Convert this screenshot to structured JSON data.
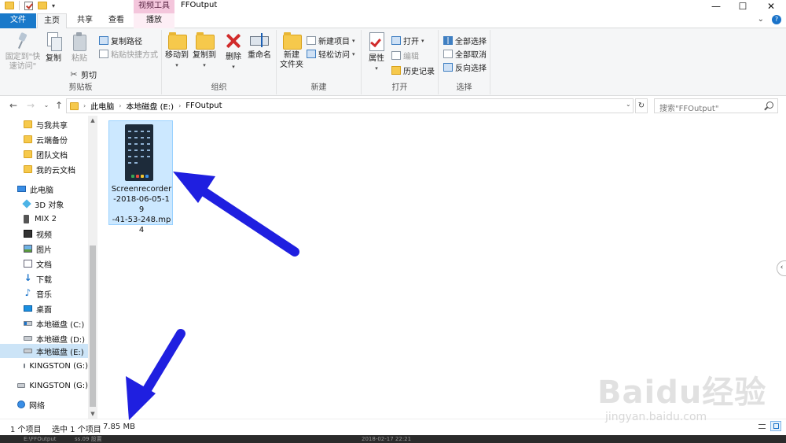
{
  "window": {
    "context_tab": "视频工具",
    "title": "FFOutput",
    "controls": {
      "minimize": "—",
      "maximize": "☐",
      "close": "✕"
    }
  },
  "tabs": {
    "file": "文件",
    "home": "主页",
    "share": "共享",
    "view": "查看",
    "play": "播放",
    "expand": "⌄"
  },
  "ribbon": {
    "clipboard": {
      "label": "剪贴板",
      "pin": "固定到\"快速访问\"",
      "copy": "复制",
      "paste": "粘贴",
      "copy_path": "复制路径",
      "paste_shortcut": "粘贴快捷方式",
      "cut": "剪切"
    },
    "organize": {
      "label": "组织",
      "move_to": "移动到",
      "copy_to": "复制到",
      "delete": "删除",
      "rename": "重命名"
    },
    "new": {
      "label": "新建",
      "new_folder": "新建\n文件夹",
      "new_item": "新建项目",
      "easy_access": "轻松访问"
    },
    "open": {
      "label": "打开",
      "properties": "属性",
      "open": "打开",
      "edit": "编辑",
      "history": "历史记录"
    },
    "select": {
      "label": "选择",
      "select_all": "全部选择",
      "select_none": "全部取消",
      "invert": "反向选择"
    }
  },
  "address": {
    "crumbs": [
      "此电脑",
      "本地磁盘 (E:)",
      "FFOutput"
    ],
    "search_placeholder": "搜索\"FFOutput\""
  },
  "nav": {
    "items": [
      {
        "label": "与我共享",
        "icon": "folder-icon"
      },
      {
        "label": "云端备份",
        "icon": "folder-icon"
      },
      {
        "label": "团队文档",
        "icon": "folder-icon"
      },
      {
        "label": "我的云文档",
        "icon": "folder-icon"
      },
      {
        "label": "此电脑",
        "icon": "computer-icon"
      },
      {
        "label": "3D 对象",
        "icon": "cube-icon"
      },
      {
        "label": "MIX 2",
        "icon": "phone-icon"
      },
      {
        "label": "视频",
        "icon": "video-icon"
      },
      {
        "label": "图片",
        "icon": "picture-icon"
      },
      {
        "label": "文档",
        "icon": "document-icon"
      },
      {
        "label": "下载",
        "icon": "download-icon"
      },
      {
        "label": "音乐",
        "icon": "music-icon"
      },
      {
        "label": "桌面",
        "icon": "desktop-icon"
      },
      {
        "label": "本地磁盘 (C:)",
        "icon": "system-drive-icon"
      },
      {
        "label": "本地磁盘 (D:)",
        "icon": "drive-icon"
      },
      {
        "label": "本地磁盘 (E:)",
        "icon": "drive-icon"
      },
      {
        "label": "KINGSTON (G:)",
        "icon": "drive-icon"
      },
      {
        "label": "KINGSTON (G:)",
        "icon": "drive-icon"
      },
      {
        "label": "网络",
        "icon": "network-icon"
      }
    ],
    "selected_index": 15
  },
  "content": {
    "file": {
      "name": "Screenrecorder-2018-06-05-19-41-53-248.mp4",
      "name_display": "Screenrecorder\n-2018-06-05-19\n-41-53-248.mp\n4"
    }
  },
  "status": {
    "count": "1 个项目",
    "selected": "选中 1 个项目",
    "size": "7.85 MB"
  },
  "taskbar": {
    "left": "E:\\FFOutput",
    "left2": "ss.09 設置",
    "mid": "2018-02-17 22:21"
  },
  "watermark": {
    "main": "Baidu经验",
    "sub": "jingyan.baidu.com"
  },
  "colors": {
    "file_tab": "#1979ca",
    "context_tab": "#f4c6dc",
    "selection": "#cce8ff",
    "arrow": "#1f1fe0"
  }
}
